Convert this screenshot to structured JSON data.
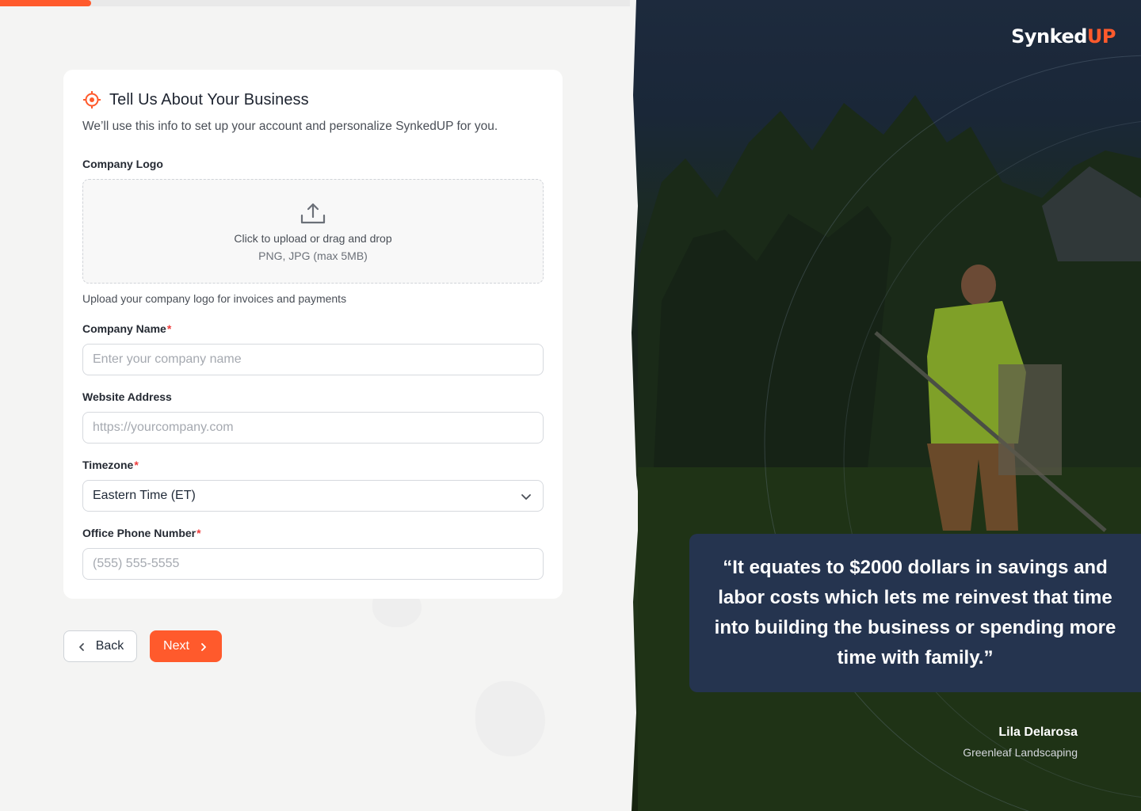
{
  "progress": {
    "percent": 8
  },
  "form": {
    "title": "Tell Us About Your Business",
    "subtitle": "We’ll use this info to set up your account and personalize SynkedUP for you.",
    "logo": {
      "label": "Company Logo",
      "upload_text": "Click to upload or drag and drop",
      "upload_formats": "PNG, JPG (max 5MB)",
      "hint": "Upload your company logo for invoices and payments"
    },
    "company_name": {
      "label": "Company Name",
      "required": "*",
      "placeholder": "Enter your company name",
      "value": ""
    },
    "website": {
      "label": "Website Address",
      "placeholder": "https://yourcompany.com",
      "value": ""
    },
    "timezone": {
      "label": "Timezone",
      "required": "*",
      "selected": "Eastern Time (ET)"
    },
    "phone": {
      "label": "Office Phone Number",
      "required": "*",
      "placeholder": "(555) 555-5555",
      "value": ""
    }
  },
  "nav": {
    "back_label": "Back",
    "next_label": "Next"
  },
  "brand": {
    "logo_main": "Synked",
    "logo_accent": "UP",
    "accent_color": "#ff5a2c",
    "quote_bg": "#25344f"
  },
  "testimonial": {
    "quote": "“It equates to $2000 dollars in savings and labor costs which lets me reinvest that time into building the business or spending more time with family.”",
    "author": "Lila Delarosa",
    "company": "Greenleaf Landscaping"
  },
  "icons": {
    "header": "target-icon",
    "upload": "upload-icon",
    "select": "chevron-down-icon",
    "back": "chevron-left-icon",
    "next": "chevron-right-icon"
  }
}
